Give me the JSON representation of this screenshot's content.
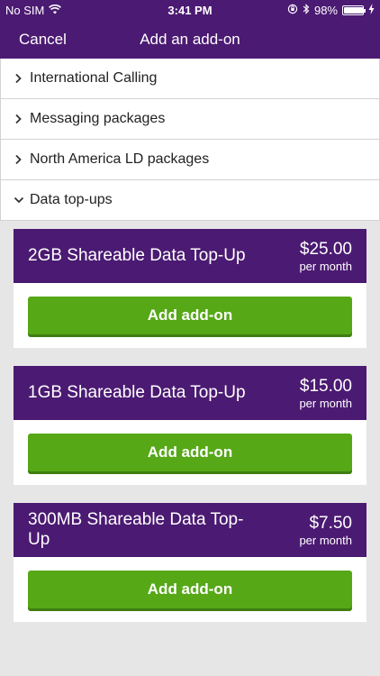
{
  "status_bar": {
    "carrier": "No SIM",
    "time": "3:41 PM",
    "battery": "98%"
  },
  "nav": {
    "cancel_label": "Cancel",
    "title": "Add an add-on"
  },
  "categories": [
    {
      "label": "International Calling",
      "expanded": false
    },
    {
      "label": "Messaging packages",
      "expanded": false
    },
    {
      "label": "North America LD packages",
      "expanded": false
    },
    {
      "label": "Data top-ups",
      "expanded": true
    }
  ],
  "addons": [
    {
      "name": "2GB Shareable Data Top-Up",
      "price": "$25.00",
      "period": "per month",
      "button_label": "Add add-on"
    },
    {
      "name": "1GB Shareable Data Top-Up",
      "price": "$15.00",
      "period": "per month",
      "button_label": "Add add-on"
    },
    {
      "name": "300MB Shareable Data Top-Up",
      "price": "$7.50",
      "period": "per month",
      "button_label": "Add add-on"
    }
  ],
  "colors": {
    "brand_purple": "#4b1a72",
    "button_green": "#56a817",
    "background": "#e6e6e6"
  }
}
